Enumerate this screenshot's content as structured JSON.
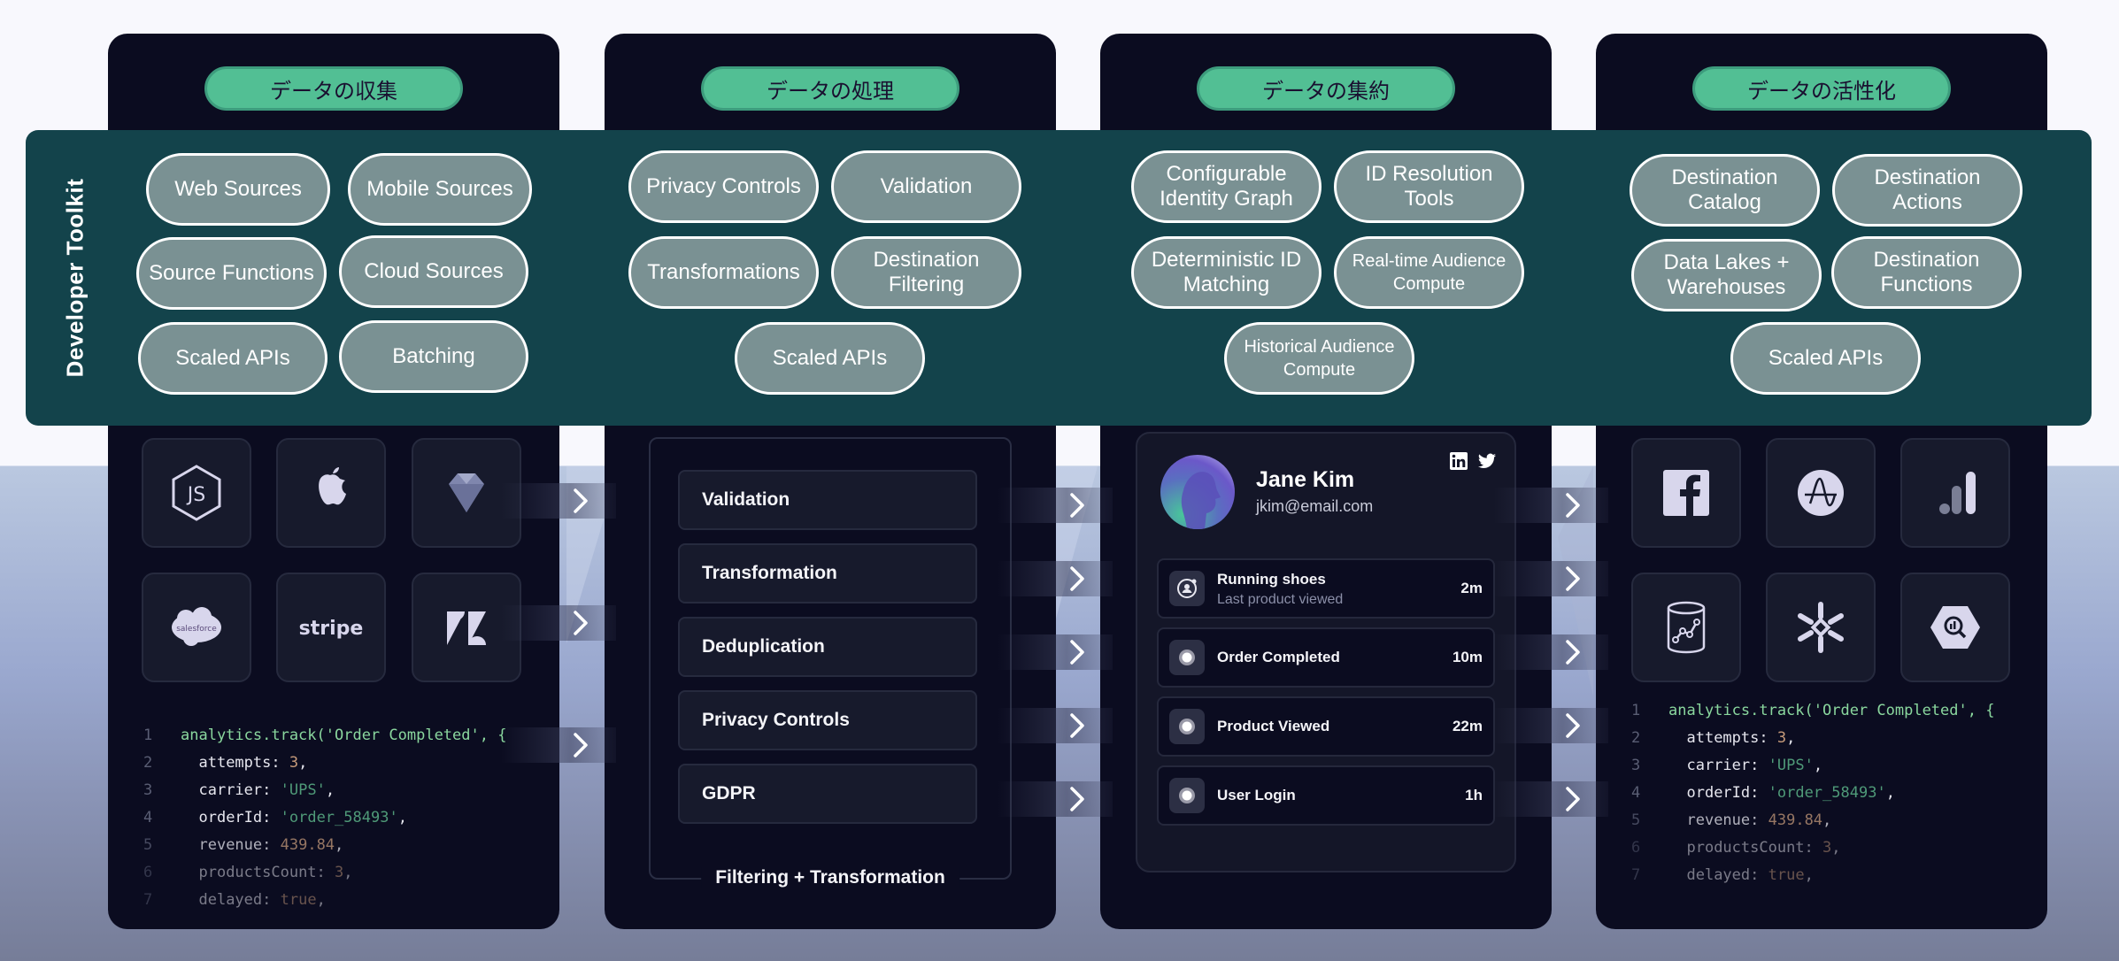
{
  "band": {
    "title": "Developer Toolkit",
    "columns": [
      {
        "pills": [
          "Web Sources",
          "Mobile Sources",
          "Source Functions",
          "Cloud Sources",
          "Scaled APIs",
          "Batching"
        ]
      },
      {
        "pills": [
          "Privacy Controls",
          "Validation",
          "Transformations",
          "Destination Filtering",
          "Scaled APIs"
        ]
      },
      {
        "pills": [
          "Configurable Identity Graph",
          "ID Resolution Tools",
          "Deterministic ID Matching",
          "Real-time Audience Compute",
          "Historical Audience Compute"
        ]
      },
      {
        "pills": [
          "Destination Catalog",
          "Destination Actions",
          "Data Lakes + Warehouses",
          "Destination Functions",
          "Scaled APIs"
        ]
      }
    ]
  },
  "cards": [
    {
      "badge": "データの収集",
      "tiles": [
        "nodejs-icon",
        "apple-icon",
        "ruby-icon",
        "salesforce-icon",
        "stripe-icon",
        "zendesk-icon"
      ],
      "tile_text": {
        "salesforce": "salesforce",
        "stripe": "stripe"
      }
    },
    {
      "badge": "データの処理",
      "steps": [
        "Validation",
        "Transformation",
        "Deduplication",
        "Privacy Controls",
        "GDPR"
      ],
      "frame_label": "Filtering + Transformation"
    },
    {
      "badge": "データの集約",
      "profile": {
        "name": "Jane Kim",
        "email": "jkim@email.com",
        "social": [
          "linkedin-icon",
          "twitter-icon"
        ],
        "events": [
          {
            "title": "Running shoes",
            "subtitle": "Last product viewed",
            "time": "2m",
            "icon": "user-circle-icon"
          },
          {
            "title": "Order Completed",
            "subtitle": "",
            "time": "10m",
            "icon": "dot-icon"
          },
          {
            "title": "Product Viewed",
            "subtitle": "",
            "time": "22m",
            "icon": "dot-icon"
          },
          {
            "title": "User Login",
            "subtitle": "",
            "time": "1h",
            "icon": "dot-icon"
          }
        ]
      }
    },
    {
      "badge": "データの活性化",
      "tiles": [
        "facebook-icon",
        "amplitude-icon",
        "google-analytics-icon",
        "data-lake-icon",
        "snowflake-icon",
        "bigquery-icon"
      ]
    }
  ],
  "code": {
    "lines": [
      {
        "n": "1",
        "text": "analytics.track('Order Completed', {"
      },
      {
        "n": "2",
        "key": "attempts",
        "value": "3"
      },
      {
        "n": "3",
        "key": "carrier",
        "value": "'UPS'"
      },
      {
        "n": "4",
        "key": "orderId",
        "value": "'order_58493'"
      },
      {
        "n": "5",
        "key": "revenue",
        "value": "439.84"
      },
      {
        "n": "6",
        "key": "productsCount",
        "value": "3"
      },
      {
        "n": "7",
        "key": "delayed",
        "value": "true"
      }
    ]
  },
  "colors": {
    "card_bg": "#0b0c20",
    "band_bg": "#13434b",
    "badge_bg": "#52bf94",
    "pill_bg": "#7a9193"
  }
}
